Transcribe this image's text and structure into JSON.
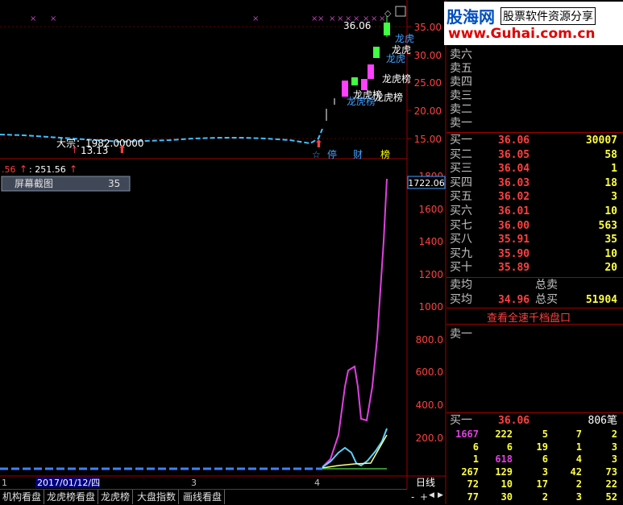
{
  "brand": {
    "name": "股海网",
    "tagline": "股票软件资源分享",
    "url": "www.Guhai.com.cn"
  },
  "main_chart": {
    "price_label": "36.06",
    "axis_ticks": [
      "35.00",
      "30.00",
      "25.00",
      "20.00",
      "15.00"
    ],
    "annotations": {
      "dragon_tiger": [
        "龙虎",
        "龙虎",
        "龙虎榜",
        "龙虎榜",
        "龙虎榜"
      ],
      "large_trade": "大宗：1982.00000",
      "low_price": "13.13"
    },
    "markers": [
      "停",
      "财",
      "榜"
    ]
  },
  "sub_chart": {
    "left_label": ".56",
    "value_label": ": 251.56",
    "current_value": "1722.06",
    "axis_ticks": [
      "1800",
      "1600",
      "1400",
      "1200",
      "1000",
      "800.0",
      "600.0",
      "400.0",
      "200.0"
    ],
    "tooltip": {
      "label": "屏幕截图",
      "value": "35"
    }
  },
  "time_axis": {
    "labels": [
      "1",
      "2017/01/12/四",
      "3",
      "4"
    ],
    "period": "日线"
  },
  "orderbook": {
    "asks": [
      {
        "label": "卖六",
        "price": "",
        "vol": ""
      },
      {
        "label": "卖五",
        "price": "",
        "vol": ""
      },
      {
        "label": "卖四",
        "price": "",
        "vol": ""
      },
      {
        "label": "卖三",
        "price": "",
        "vol": ""
      },
      {
        "label": "卖二",
        "price": "",
        "vol": ""
      },
      {
        "label": "卖一",
        "price": "",
        "vol": ""
      }
    ],
    "bids": [
      {
        "label": "买一",
        "price": "36.06",
        "vol": "30007"
      },
      {
        "label": "买二",
        "price": "36.05",
        "vol": "58"
      },
      {
        "label": "买三",
        "price": "36.04",
        "vol": "1"
      },
      {
        "label": "买四",
        "price": "36.03",
        "vol": "18"
      },
      {
        "label": "买五",
        "price": "36.02",
        "vol": "3"
      },
      {
        "label": "买六",
        "price": "36.01",
        "vol": "10"
      },
      {
        "label": "买七",
        "price": "36.00",
        "vol": "563"
      },
      {
        "label": "买八",
        "price": "35.91",
        "vol": "35"
      },
      {
        "label": "买九",
        "price": "35.90",
        "vol": "10"
      },
      {
        "label": "买十",
        "price": "35.89",
        "vol": "20"
      }
    ],
    "ask_avg": {
      "label": "卖均",
      "total_label": "总卖",
      "price": "",
      "vol": ""
    },
    "bid_avg": {
      "label": "买均",
      "price": "34.96",
      "total_label": "总买",
      "vol": "51904"
    },
    "full_depth_link": "查看全速千档盘口",
    "queue_sell_label": "卖一",
    "queue_buy": {
      "label": "买一",
      "price": "36.06",
      "count": "806笔"
    },
    "queue_rows": [
      [
        "1667",
        "222",
        "5",
        "7",
        "2"
      ],
      [
        "6",
        "6",
        "19",
        "1",
        "3"
      ],
      [
        "1",
        "618",
        "6",
        "4",
        "3"
      ],
      [
        "267",
        "129",
        "3",
        "42",
        "73"
      ],
      [
        "72",
        "10",
        "17",
        "2",
        "22"
      ],
      [
        "77",
        "30",
        "2",
        "3",
        "52"
      ]
    ]
  },
  "tabs": [
    "机构看盘",
    "龙虎榜看盘",
    "龙虎榜",
    "大盘指数",
    "画线看盘"
  ],
  "nav": [
    "-",
    "+",
    "◀",
    "▶"
  ]
}
